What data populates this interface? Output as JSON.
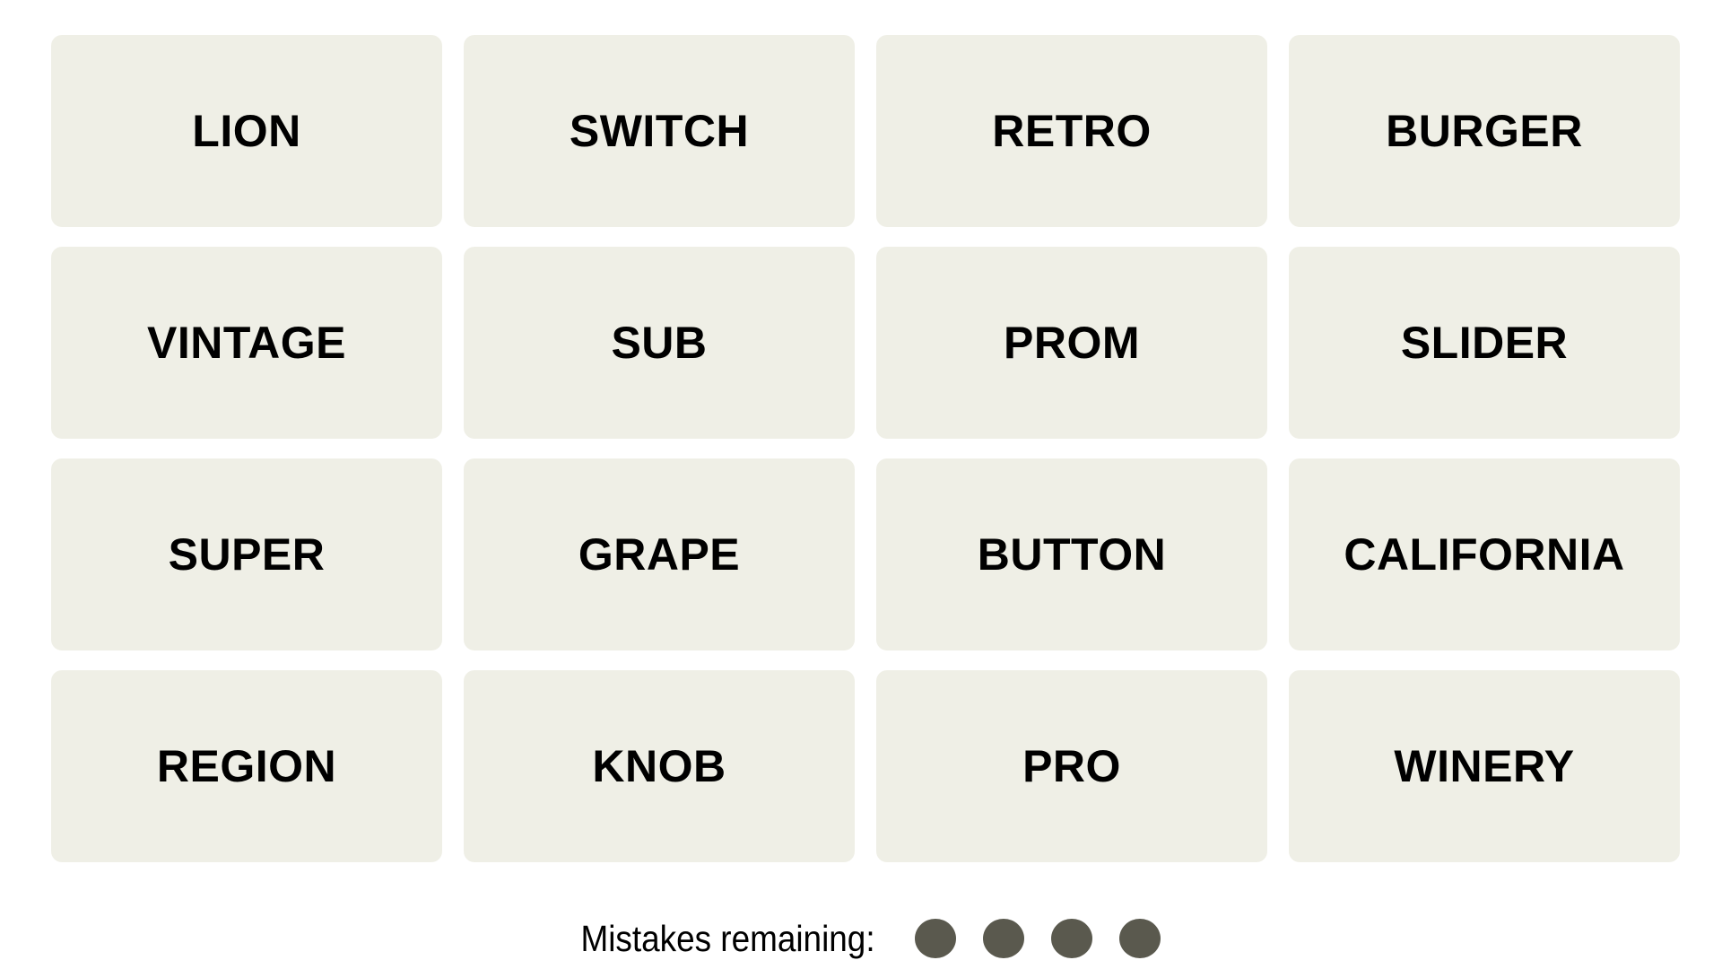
{
  "tiles": [
    "LION",
    "SWITCH",
    "RETRO",
    "BURGER",
    "VINTAGE",
    "SUB",
    "PROM",
    "SLIDER",
    "SUPER",
    "GRAPE",
    "BUTTON",
    "CALIFORNIA",
    "REGION",
    "KNOB",
    "PRO",
    "WINERY"
  ],
  "mistakes": {
    "label": "Mistakes remaining:",
    "remaining": 4,
    "dot_color": "#5a594e"
  },
  "colors": {
    "tile_background": "#efefe6",
    "tile_text": "#000000"
  }
}
